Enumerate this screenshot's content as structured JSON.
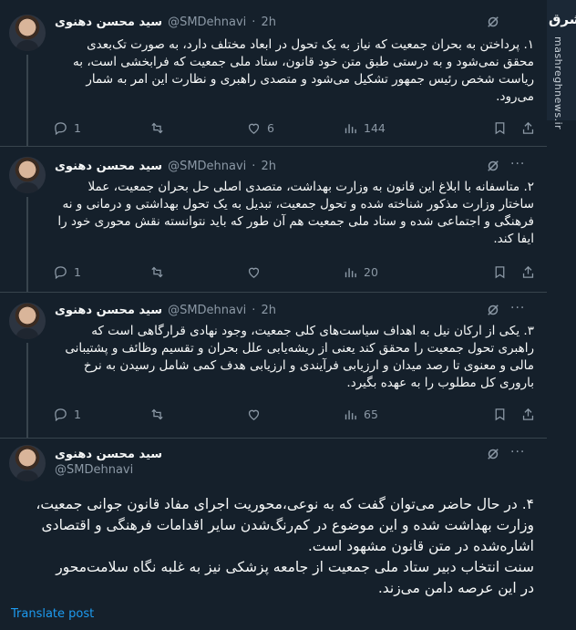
{
  "author": {
    "name": "سید محسن دهنوی",
    "handle": "@SMDehnavi",
    "dot": "·"
  },
  "logo": {
    "mark": "مشرق",
    "site": "mashreghnews.ir"
  },
  "tweets": [
    {
      "time": "2h",
      "text": "۱. پرداختن به بحران جمعیت که نیاز به یک تحول در ابعاد مختلف دارد، به صورت تک‌بعدی محقق نمی‌شود و به درستی طبق متن خود قانون، ستاد ملی جمعیت که فرابخشی است، به ریاست شخص رئیس جمهور تشکیل می‌شود و متصدی راهبری و نظارت این امر به شمار می‌رود.",
      "replies": "1",
      "retweets": "",
      "likes": "6",
      "views": "144"
    },
    {
      "time": "2h",
      "text": "۲. متاسفانه با ابلاغ این قانون به وزارت بهداشت، متصدی اصلی حل بحران جمعیت، عملا ساختار وزارت مذکور شناخته شده و تحول جمعیت، تبدیل به یک تحول بهداشتی و درمانی و نه فرهنگی و اجتماعی شده و ستاد ملی جمعیت هم آن طور که باید نتوانسته نقش محوری خود را ایفا کند.",
      "replies": "1",
      "retweets": "",
      "likes": "",
      "views": "20"
    },
    {
      "time": "2h",
      "text": "۳. یکی از ارکان نیل به اهداف سیاست‌های کلی جمعیت، وجود نهادی قرارگاهی است که راهبری تحول جمعیت را محقق کند یعنی از ریشه‌یابی علل بحران و تقسیم وظائف و پشتیبانی مالی و معنوی تا رصد میدان و ارزیابی فرآیندی و ارزیابی هدف کمی شامل رسیدن به نرخ باروری کل مطلوب را به عهده بگیرد.",
      "replies": "1",
      "retweets": "",
      "likes": "",
      "views": "65"
    }
  ],
  "main_tweet": {
    "handle": "@SMDehnavi",
    "text_lines": [
      "۴. در حال حاضر می‌توان گفت که به نوعی،محوریت اجرای مفاد قانون جوانی جمعیت،",
      "وزارت بهداشت شده و این موضوع در کم‌رنگ‌شدن سایر اقدامات فرهنگی و اقتصادی",
      "اشاره‌شده در متن قانون مشهود است.",
      "سنت انتخاب دبیر ستاد ملی جمعیت از جامعه پزشکی نیز به غلبه نگاه سلامت‌محور",
      "در این عرصه دامن می‌زند."
    ],
    "translate_label": "Translate post"
  },
  "icons": [
    "grok-icon",
    "more-icon",
    "reply-icon",
    "retweet-icon",
    "like-icon",
    "views-icon",
    "bookmark-icon",
    "share-icon"
  ]
}
